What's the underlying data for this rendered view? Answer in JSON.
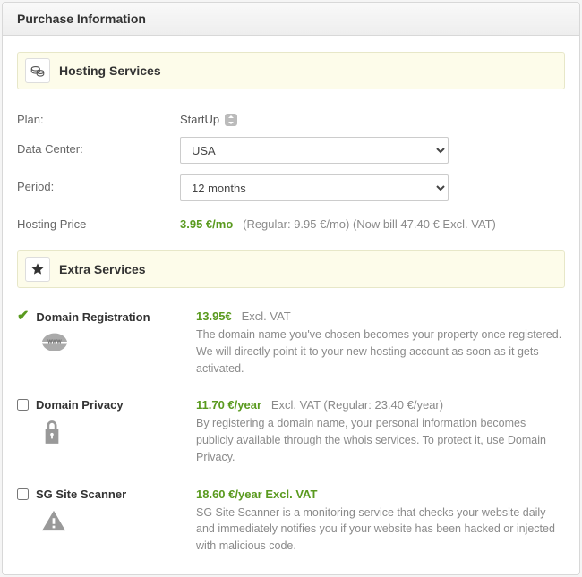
{
  "header": {
    "title": "Purchase Information"
  },
  "sections": {
    "hosting_title": "Hosting Services",
    "extras_title": "Extra Services"
  },
  "plan": {
    "label": "Plan:",
    "value": "StartUp"
  },
  "datacenter": {
    "label": "Data Center:",
    "options": [
      "USA"
    ],
    "selected": "USA"
  },
  "period": {
    "label": "Period:",
    "options": [
      "12 months"
    ],
    "selected": "12 months"
  },
  "hosting_price": {
    "label": "Hosting Price",
    "price": "3.95 €/mo",
    "regular": "(Regular: 9.95 €/mo)",
    "now_bill": "(Now bill 47.40 € Excl. VAT)"
  },
  "extras": {
    "domain_reg": {
      "title": "Domain Registration",
      "checked": true,
      "price": "13.95€",
      "excl": "Excl. VAT",
      "desc": "The domain name you've chosen becomes your property once registered. We will directly point it to your new hosting account as soon as it gets activated."
    },
    "domain_privacy": {
      "title": "Domain Privacy",
      "checked": false,
      "price": "11.70 €/year",
      "excl": "Excl. VAT",
      "regular": "(Regular: 23.40 €/year)",
      "desc": "By registering a domain name, your personal information becomes publicly available through the whois services. To protect it, use Domain Privacy."
    },
    "site_scanner": {
      "title": "SG Site Scanner",
      "checked": false,
      "price_line": "18.60 €/year Excl. VAT",
      "desc": "SG Site Scanner is a monitoring service that checks your website daily and immediately notifies you if your website has been hacked or injected with malicious code."
    }
  }
}
